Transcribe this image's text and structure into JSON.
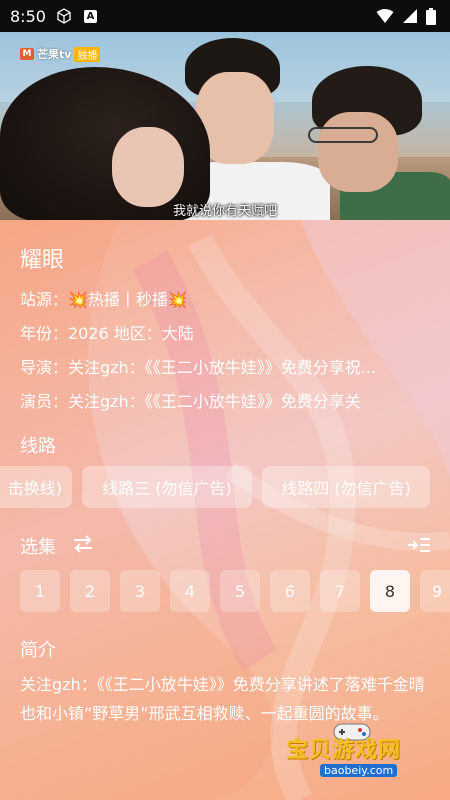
{
  "status_bar": {
    "time": "8:50",
    "icons": [
      "cube-icon",
      "a-notification-icon",
      "wifi-icon",
      "signal-icon",
      "battery-icon"
    ]
  },
  "video": {
    "logo_mark": "M",
    "logo_text": "芒果tv",
    "logo_badge": "独播",
    "subtitle": "我就说你有天赋吧"
  },
  "detail": {
    "title": "耀眼",
    "source": "站源：💥热播丨秒播💥",
    "year_region": "年份：2026  地区：大陆",
    "director": "导演：关注gzh：《《王二小放牛娃》》免费分享祝...",
    "actors": "演员：关注gzh：《《王二小放牛娃》》免费分享关"
  },
  "routes": {
    "label": "线路",
    "items": [
      "击换线)",
      "线路三 (勿信广告)",
      "线路四 (勿信广告)"
    ]
  },
  "episodes": {
    "label": "选集",
    "items": [
      "1",
      "2",
      "3",
      "4",
      "5",
      "6",
      "7",
      "8",
      "9"
    ],
    "selected": "8"
  },
  "synopsis": {
    "label": "简介",
    "text": "关注gzh：《《王二小放牛娃》》免费分享讲述了落难千金晴也和小镇“野草男”邢武互相救赎、一起重圆的故事。"
  },
  "watermark": {
    "text": "宝贝游戏网",
    "url": "baobeiy.com"
  },
  "colors": {
    "background_top": "#f7a98a",
    "background_mid": "#f3c7c3",
    "accent_text": "#ffffff",
    "status_bar": "#0d0d0d"
  }
}
